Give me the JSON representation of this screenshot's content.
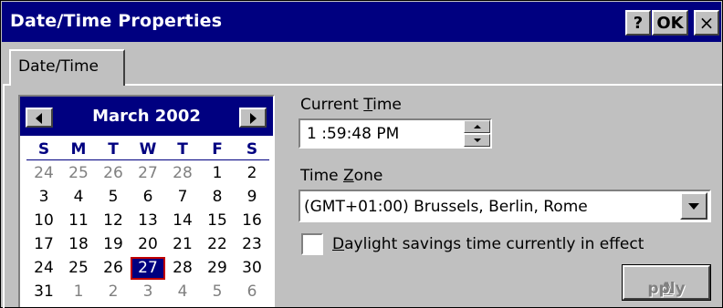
{
  "window": {
    "title": "Date/Time Properties",
    "help_label": "?",
    "ok_label": "OK",
    "close_label": "×"
  },
  "tabs": [
    {
      "label": "Date/Time",
      "active": true
    }
  ],
  "calendar": {
    "month_label": "March 2002",
    "weekdays": [
      "S",
      "M",
      "T",
      "W",
      "T",
      "F",
      "S"
    ],
    "weeks": [
      [
        "24",
        "25",
        "26",
        "27",
        "28",
        "1",
        "2"
      ],
      [
        "3",
        "4",
        "5",
        "6",
        "7",
        "8",
        "9"
      ],
      [
        "10",
        "11",
        "12",
        "13",
        "14",
        "15",
        "16"
      ],
      [
        "17",
        "18",
        "19",
        "20",
        "21",
        "22",
        "23"
      ],
      [
        "24",
        "25",
        "26",
        "27",
        "28",
        "29",
        "30"
      ],
      [
        "31",
        "1",
        "2",
        "3",
        "4",
        "5",
        "6"
      ]
    ],
    "selected_day": "27",
    "prev_icon": "triangle-left-icon",
    "next_icon": "triangle-right-icon"
  },
  "current_time": {
    "label_pre": "Current ",
    "label_mnemonic": "T",
    "label_post": "ime",
    "value": "1 :59:48 PM"
  },
  "time_zone": {
    "label_pre": "Time ",
    "label_mnemonic": "Z",
    "label_post": "one",
    "value": "(GMT+01:00) Brussels, Berlin, Rome"
  },
  "daylight": {
    "label_mnemonic": "D",
    "label_post": "aylight savings time currently in effect",
    "checked": false
  },
  "apply": {
    "label_mnemonic": "A",
    "label_post": "pply",
    "enabled": false
  },
  "colors": {
    "title_bar": "#000080",
    "face": "#c0c0c0",
    "selected_outline": "#c00000"
  }
}
